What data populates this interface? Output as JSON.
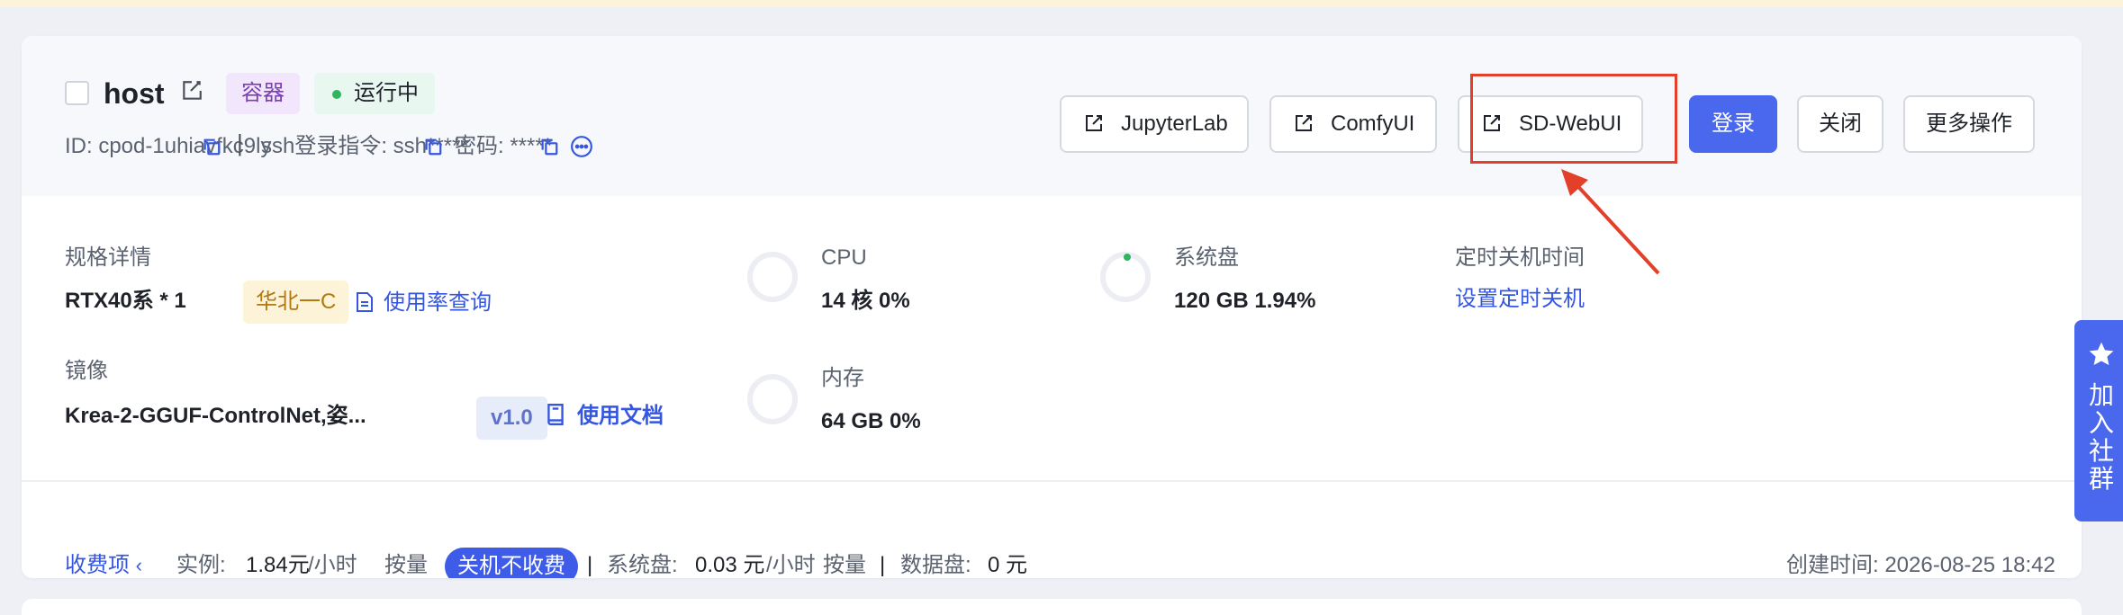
{
  "instance": {
    "name": "host",
    "tag_type": "容器",
    "status": "运行中",
    "id_text": "ID: cpod-1uhiavfkc9ly",
    "separator": "|",
    "ssh_text": "ssh登录指令: ssh*****",
    "password_text": "密码: *****"
  },
  "actions": {
    "jupyter": "JupyterLab",
    "comfy": "ComfyUI",
    "sdwebui": "SD-WebUI",
    "login": "登录",
    "close": "关闭",
    "more": "更多操作"
  },
  "spec": {
    "label": "规格详情",
    "gpu": "RTX40系 * 1",
    "region": "华北一C",
    "usage_link": "使用率查询"
  },
  "image": {
    "label": "镜像",
    "name": "Krea-2-GGUF-ControlNet,姿...",
    "version": "v1.0",
    "docs_link": "使用文档"
  },
  "cpu": {
    "label": "CPU",
    "value": "14 核 0%"
  },
  "memory": {
    "label": "内存",
    "value": "64 GB 0%"
  },
  "disk": {
    "label": "系统盘",
    "value": "120 GB 1.94%"
  },
  "shutdown": {
    "label": "定时关机时间",
    "link": "设置定时关机"
  },
  "billing": {
    "toggle": "收费项",
    "instance_label": "实例:",
    "instance_price": "1.84元",
    "instance_unit": "/小时",
    "instance_mode": "按量",
    "off_badge": "关机不收费",
    "sep": "|",
    "disk_label": "系统盘:",
    "disk_price": "0.03 元",
    "disk_unit": "/小时",
    "disk_mode": "按量",
    "data_label": "数据盘:",
    "data_price": "0 元",
    "created": "创建时间: 2026-08-25 18:42"
  },
  "side_tab": {
    "label": "加入社群"
  },
  "colors": {
    "primary": "#4a68ee",
    "highlight": "#e3402a",
    "running": "#2fb560"
  }
}
